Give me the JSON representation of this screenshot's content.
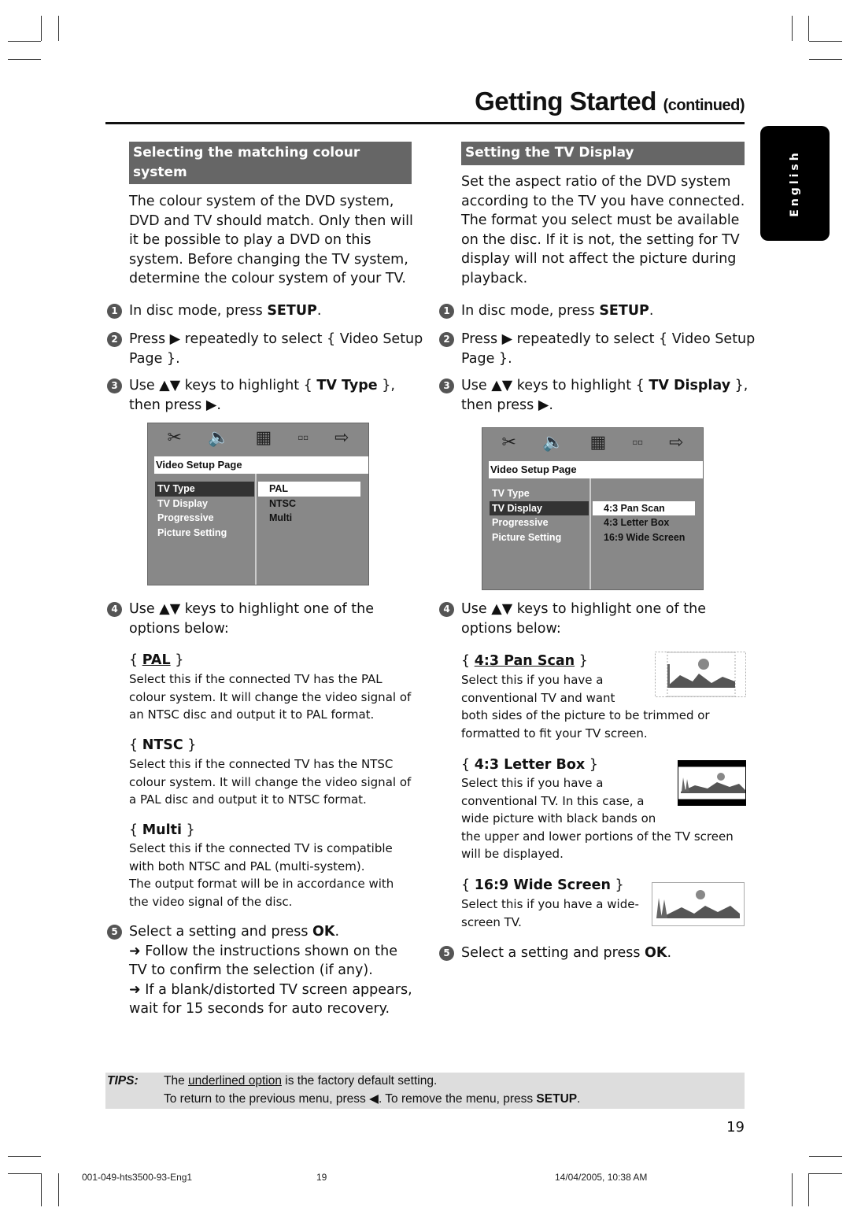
{
  "header": {
    "title": "Getting Started",
    "title_suffix": "(continued)",
    "language_tab": "English"
  },
  "left": {
    "section_title": "Selecting the matching colour system",
    "intro": [
      "The colour system of the DVD system,",
      "DVD and TV should match. Only then will",
      "it be possible to play a DVD on this",
      "system.  Before changing the TV system,",
      "determine the colour system of your TV."
    ],
    "steps": [
      {
        "num": "1",
        "pre": "In disc mode, press ",
        "bold": "SETUP",
        "post": "."
      },
      {
        "num": "2",
        "line1": "Press ▶ repeatedly to select { Video Setup",
        "line2": "Page }."
      },
      {
        "num": "3",
        "pre": "Use ▲▼ keys to highlight { ",
        "bold": "TV Type",
        "post": " },",
        "line2": "then press ▶."
      },
      {
        "num": "4",
        "line1": "Use ▲▼ keys to highlight one of the",
        "line2": "options below:"
      },
      {
        "num": "5",
        "pre": "Select a setting and press ",
        "bold": "OK",
        "post": "."
      }
    ],
    "menu": {
      "page_label": "Video Setup Page",
      "items": [
        "TV Type",
        "TV Display",
        "Progressive",
        "Picture Setting"
      ],
      "selected_item": "TV Type",
      "options": [
        "PAL",
        "NTSC",
        "Multi"
      ],
      "selected_option": "PAL"
    },
    "options": [
      {
        "name": "PAL",
        "default": true,
        "desc": [
          "Select this if the connected TV has the PAL",
          "colour system. It will change the video signal of",
          "an NTSC disc and output it to PAL format."
        ]
      },
      {
        "name": "NTSC",
        "default": false,
        "desc": [
          "Select this if the connected TV has the NTSC",
          "colour system. It will change the video signal of",
          "a PAL disc and output it to NTSC format."
        ]
      },
      {
        "name": "Multi",
        "default": false,
        "desc": [
          "Select this if the connected TV is compatible",
          "with both NTSC and PAL (multi-system).",
          "The output format will be in accordance with",
          "the video signal of the disc."
        ]
      }
    ],
    "result_notes": [
      "➜ Follow the instructions shown on the",
      "TV to confirm the selection (if any).",
      "➜ If a blank/distorted TV screen appears,",
      "wait for 15 seconds for auto recovery."
    ]
  },
  "right": {
    "section_title": "Setting the TV Display",
    "intro": [
      "Set the aspect ratio of the DVD system",
      "according to the TV you have connected.",
      "The format you select must be available",
      "on the disc.  If it is not, the setting for TV",
      "display will not affect the picture during",
      "playback."
    ],
    "steps": [
      {
        "num": "1",
        "pre": "In disc mode, press ",
        "bold": "SETUP",
        "post": "."
      },
      {
        "num": "2",
        "line1": "Press ▶ repeatedly to select { Video Setup",
        "line2": "Page }."
      },
      {
        "num": "3",
        "pre": "Use ▲▼ keys to highlight { ",
        "bold": "TV Display",
        "post": " },",
        "line2": "then press ▶."
      },
      {
        "num": "4",
        "line1": "Use ▲▼ keys to highlight one of the",
        "line2": "options below:"
      },
      {
        "num": "5",
        "pre": "Select a setting and press ",
        "bold": "OK",
        "post": "."
      }
    ],
    "menu": {
      "page_label": "Video Setup Page",
      "items": [
        "TV Type",
        "TV Display",
        "Progressive",
        "Picture Setting"
      ],
      "selected_item": "TV Display",
      "options": [
        "4:3 Pan Scan",
        "4:3 Letter Box",
        "16:9 Wide Screen"
      ],
      "selected_option": "4:3 Pan Scan"
    },
    "options": [
      {
        "name": "4:3 Pan Scan",
        "default": true,
        "desc": [
          "Select this if you have a",
          "conventional TV and want",
          "both sides of the picture to be trimmed or",
          "formatted to fit your TV screen."
        ],
        "image": "pan-scan-illustration"
      },
      {
        "name": "4:3 Letter Box",
        "default": false,
        "desc": [
          "Select this if you have a",
          "conventional TV.  In this case, a",
          "wide picture with black bands on",
          "the upper and lower portions of the TV screen",
          "will be displayed."
        ],
        "image": "letter-box-illustration"
      },
      {
        "name": "16:9 Wide Screen",
        "default": false,
        "desc": [
          "Select this if you have a wide-",
          "screen TV."
        ],
        "image": "wide-screen-illustration"
      }
    ]
  },
  "menu_icons": [
    "tools-icon",
    "speaker-icon",
    "film-icon",
    "preference-icon",
    "exit-icon"
  ],
  "tips": {
    "label": "TIPS:",
    "line1_pre": "The ",
    "line1_link": "underlined option",
    "line1_post": " is the factory default setting.",
    "line2_pre": "To return to the previous menu, press ◀.  To remove the menu, press ",
    "line2_bold": "SETUP",
    "line2_post": "."
  },
  "page_number": "19",
  "footer": {
    "file": "001-049-hts3500-93-Eng1",
    "page": "19",
    "datetime": "14/04/2005, 10:38 AM"
  }
}
